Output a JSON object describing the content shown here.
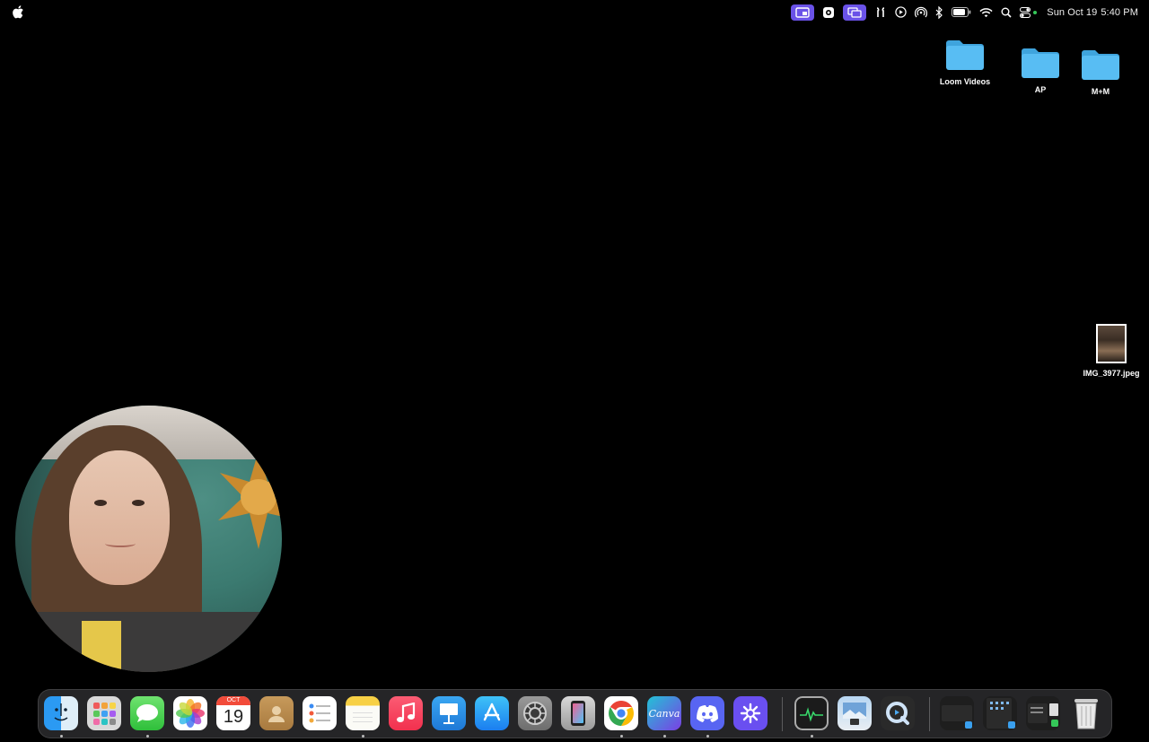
{
  "menubar": {
    "apple_icon": "apple-icon",
    "clock": {
      "date": "Sun Oct 19",
      "time": "5:40 PM"
    },
    "tray_icons": [
      "screen-share-icon",
      "camera-icon",
      "windows-icon",
      "airpods-icon",
      "play-circle-icon",
      "airdrop-icon",
      "bluetooth-icon",
      "battery-icon",
      "wifi-icon",
      "search-icon",
      "control-center-icon"
    ]
  },
  "desktop": {
    "items": [
      {
        "name": "Loom Videos",
        "kind": "folder"
      },
      {
        "name": "AP",
        "kind": "folder"
      },
      {
        "name": "M+M",
        "kind": "folder"
      },
      {
        "name": "IMG_3977.jpeg",
        "kind": "image"
      }
    ]
  },
  "dock": {
    "calendar": {
      "month": "OCT",
      "day": "19"
    },
    "canva_label": "Canva",
    "apps": [
      "Finder",
      "Launchpad",
      "Messages",
      "Photos",
      "Calendar",
      "Contacts",
      "Reminders",
      "Notes",
      "Music",
      "Keynote",
      "App Store",
      "System Settings",
      "iPhone Mirroring",
      "Google Chrome",
      "Canva",
      "Discord",
      "Perplexity",
      "Activity Monitor",
      "Preview",
      "QuickTime Player",
      "Downloads",
      "Stack 2",
      "Stack 3",
      "Trash"
    ]
  },
  "colors": {
    "menu_accent": "#6a52e8",
    "folder": "#4fb7f0",
    "desktop": "#000000"
  }
}
